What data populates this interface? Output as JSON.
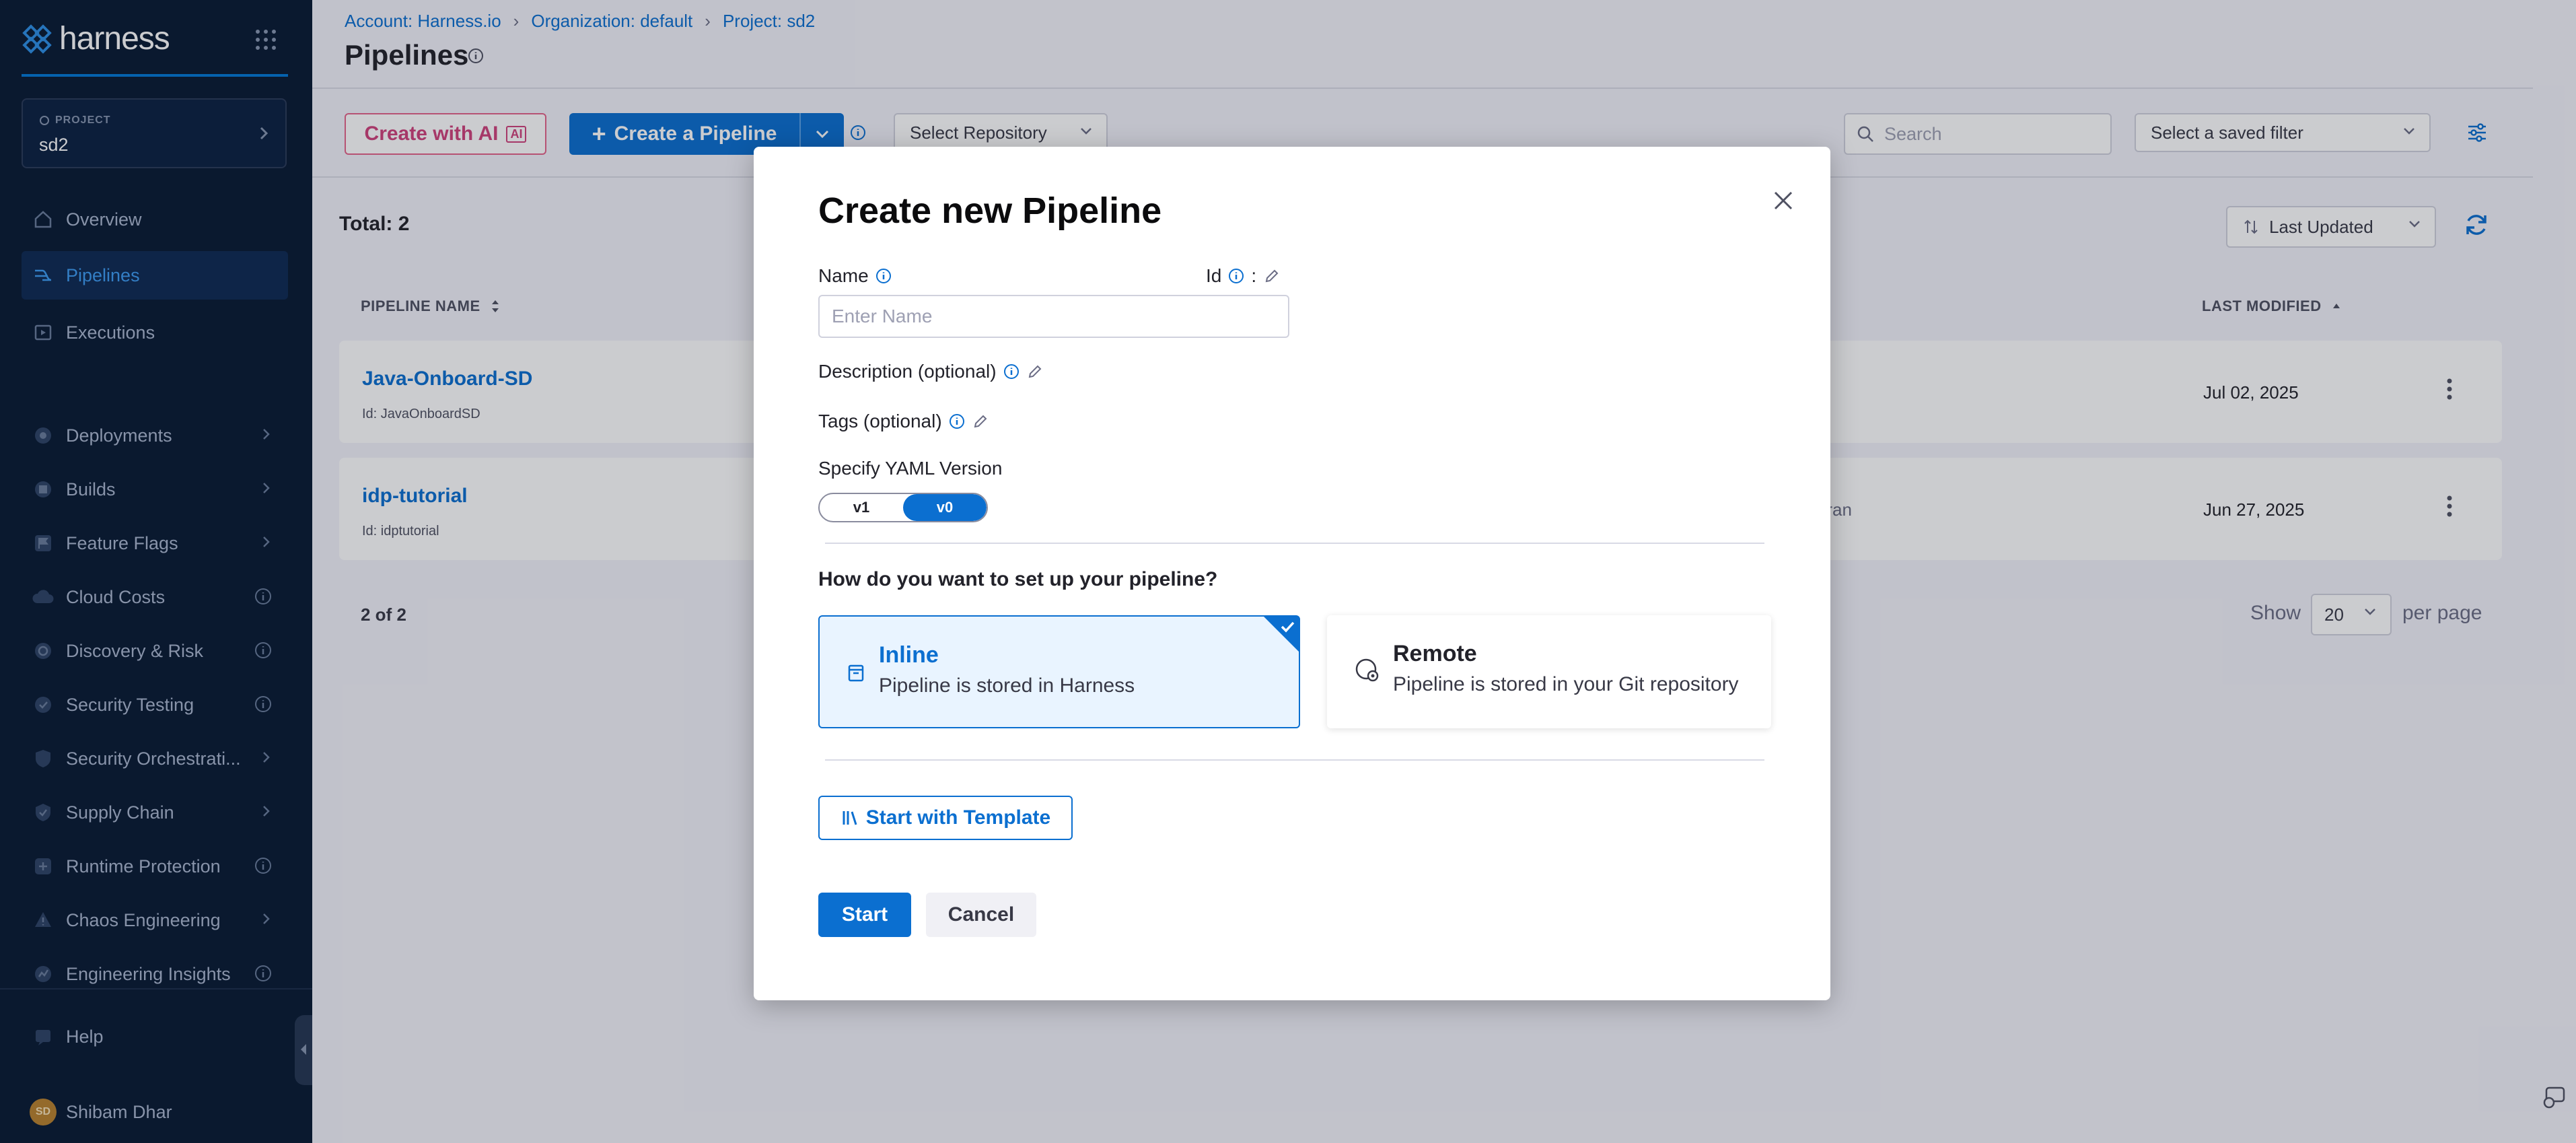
{
  "sidebar": {
    "logo_text": "harness",
    "project_label": "PROJECT",
    "project_name": "sd2",
    "items": [
      {
        "label": "Overview"
      },
      {
        "label": "Pipelines"
      },
      {
        "label": "Executions"
      },
      {
        "label": "Deployments"
      },
      {
        "label": "Builds"
      },
      {
        "label": "Feature Flags"
      },
      {
        "label": "Cloud Costs"
      },
      {
        "label": "Discovery & Risk"
      },
      {
        "label": "Security Testing"
      },
      {
        "label": "Security Orchestrati..."
      },
      {
        "label": "Supply Chain"
      },
      {
        "label": "Runtime Protection"
      },
      {
        "label": "Chaos Engineering"
      },
      {
        "label": "Engineering Insights"
      }
    ],
    "help_label": "Help",
    "user_initials": "SD",
    "user_name": "Shibam Dhar"
  },
  "breadcrumbs": [
    "Account: Harness.io",
    "Organization: default",
    "Project: sd2"
  ],
  "page_title": "Pipelines",
  "toolbar": {
    "create_ai_label": "Create with AI",
    "ai_badge": "AI",
    "create_pipeline_label": "Create a Pipeline",
    "select_repository": "Select Repository",
    "search_placeholder": "Search",
    "saved_filter": "Select a saved filter"
  },
  "list": {
    "total": "Total: 2",
    "sort_label": "Last Updated",
    "col_name": "PIPELINE NAME",
    "col_modified": "LAST MODIFIED",
    "rows": [
      {
        "name": "Java-Onboard-SD",
        "id": "Id: JavaOnboardSD",
        "modified": "Jul 02, 2025",
        "extra": ""
      },
      {
        "name": "idp-tutorial",
        "id": "Id: idptutorial",
        "modified": "Jun 27, 2025",
        "extra": "er ran"
      }
    ],
    "count": "2 of 2",
    "show": "Show",
    "page_size": "20",
    "per_page": "per page"
  },
  "modal": {
    "title": "Create new Pipeline",
    "name_label": "Name",
    "id_label": "Id",
    "id_colon": ":",
    "name_placeholder": "Enter Name",
    "description_label": "Description (optional)",
    "tags_label": "Tags (optional)",
    "yaml_label": "Specify YAML Version",
    "yaml_options": [
      "v1",
      "v0"
    ],
    "yaml_selected": "v0",
    "setup_question": "How do you want to set up your pipeline?",
    "inline_title": "Inline",
    "inline_sub": "Pipeline is stored in Harness",
    "remote_title": "Remote",
    "remote_sub": "Pipeline is stored in your Git repository",
    "template_label": "Start with Template",
    "start_label": "Start",
    "cancel_label": "Cancel"
  },
  "colors": {
    "sidebar_bg": "#081a33",
    "primary": "#0b6fd0",
    "ai_pink": "#d0427c",
    "selected_card_bg": "#e9f4ff"
  }
}
